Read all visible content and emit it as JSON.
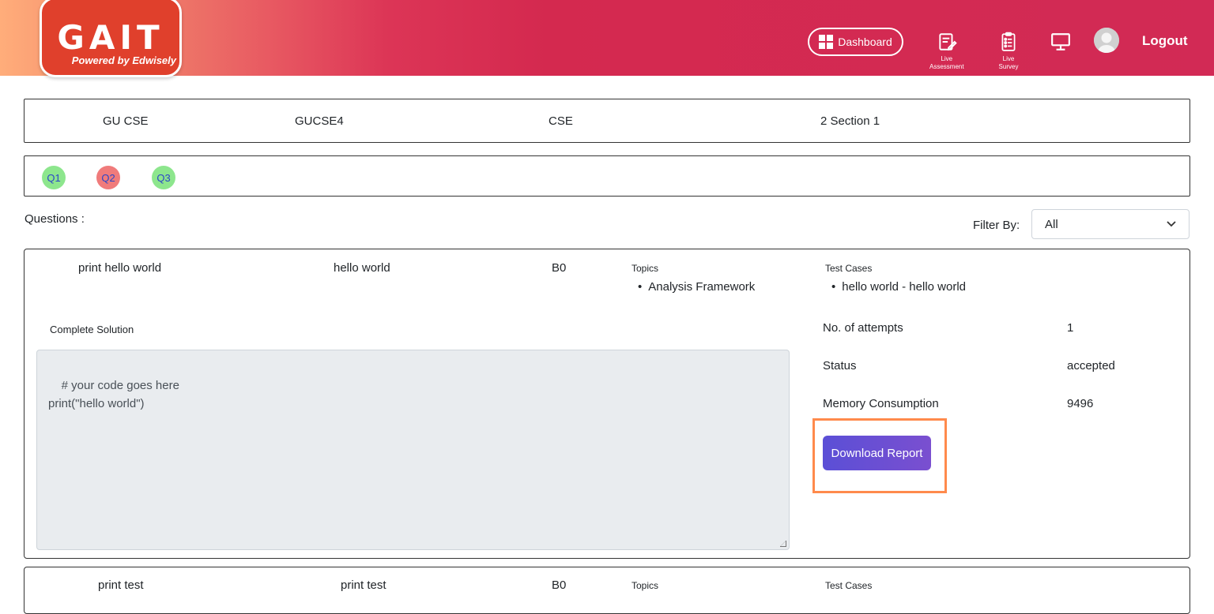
{
  "header": {
    "logo_title": "GAIT",
    "logo_subtitle": "Powered by Edwisely",
    "dashboard_label": "Dashboard",
    "live_assessment": [
      "Live",
      "Assessment"
    ],
    "live_survey": [
      "Live",
      "Survey"
    ],
    "logout_label": "Logout"
  },
  "info": [
    "GU CSE",
    "GUCSE4",
    "CSE",
    "2 Section 1"
  ],
  "questions": [
    {
      "label": "Q1",
      "color": "#8de68d"
    },
    {
      "label": "Q2",
      "color": "#f07b7b"
    },
    {
      "label": "Q3",
      "color": "#8de68d"
    }
  ],
  "questions_label": "Questions :",
  "filter": {
    "label": "Filter By:",
    "value": "All"
  },
  "card1": {
    "title": "print hello world",
    "output": "hello world",
    "level": "B0",
    "topics_label": "Topics",
    "topics": [
      "Analysis Framework"
    ],
    "testcases_label": "Test Cases",
    "testcases": [
      "hello world - hello world"
    ],
    "solution_label": "Complete Solution",
    "code": "# your code goes here\nprint(\"hello world\")",
    "attempts_label": "No. of attempts",
    "attempts": "1",
    "status_label": "Status",
    "status": "accepted",
    "memory_label": "Memory Consumption",
    "memory": "9496",
    "download_label": "Download Report"
  },
  "card2": {
    "title": "print test",
    "output": "print test",
    "level": "B0",
    "topics_label": "Topics",
    "testcases_label": "Test Cases"
  }
}
